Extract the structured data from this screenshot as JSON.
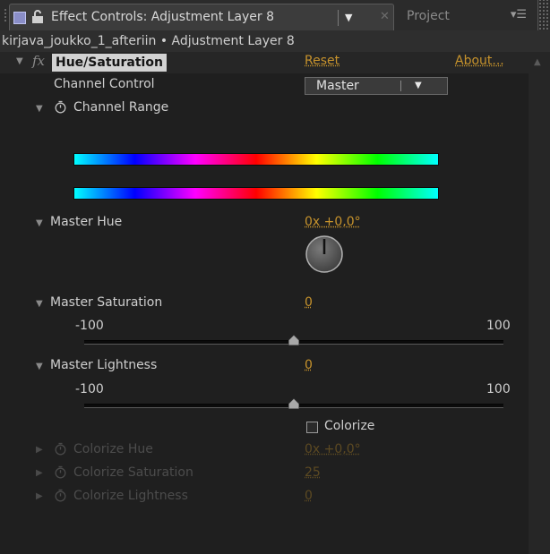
{
  "tabs": {
    "active_title": "Effect Controls: Adjustment Layer 8",
    "inactive_title": "Project",
    "menu_arrow": "▼",
    "close_glyph": "✕",
    "panel_menu_glyph": "▾☰"
  },
  "layer_header": "kirjava_joukko_1_afteriin • Adjustment Layer 8",
  "effect": {
    "name": "Hue/Saturation",
    "fx_glyph": "fx",
    "reset": "Reset",
    "about": "About..."
  },
  "channel_control": {
    "label": "Channel Control",
    "value": "Master",
    "options": [
      "Master"
    ]
  },
  "channel_range": {
    "label": "Channel Range"
  },
  "master_hue": {
    "label": "Master Hue",
    "value": "0x +0,0°"
  },
  "master_saturation": {
    "label": "Master Saturation",
    "value": "0",
    "min_label": "-100",
    "max_label": "100",
    "position": 0.5
  },
  "master_lightness": {
    "label": "Master Lightness",
    "value": "0",
    "min_label": "-100",
    "max_label": "100",
    "position": 0.5
  },
  "colorize": {
    "label": "Colorize",
    "checked": false
  },
  "colorize_hue": {
    "label": "Colorize Hue",
    "value": "0x +0,0°"
  },
  "colorize_saturation": {
    "label": "Colorize Saturation",
    "value": "25"
  },
  "colorize_lightness": {
    "label": "Colorize Lightness",
    "value": "0"
  },
  "colors": {
    "accent": "#c7932c",
    "background": "#1f1f1f"
  }
}
